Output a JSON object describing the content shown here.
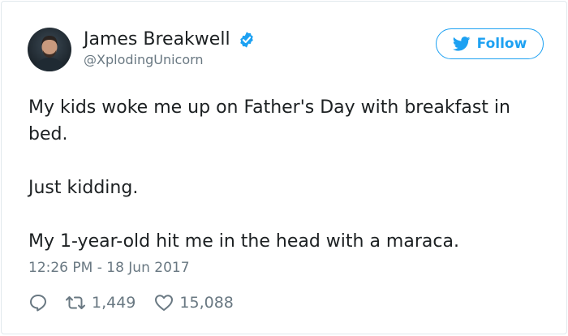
{
  "author": {
    "display_name": "James Breakwell",
    "username": "@XplodingUnicorn",
    "verified": true,
    "avatar_icon": "profile-photo"
  },
  "follow_button": {
    "label": "Follow",
    "icon": "twitter-bird-icon",
    "color": "#1da1f2"
  },
  "tweet": {
    "paragraphs": [
      "My kids woke me up on Father's Day with breakfast in bed.",
      "Just kidding.",
      "My 1-year-old hit me in the head with a maraca."
    ],
    "timestamp": "12:26 PM - 18 Jun 2017"
  },
  "actions": {
    "reply": {
      "icon": "reply-icon"
    },
    "retweet": {
      "icon": "retweet-icon",
      "count": "1,449"
    },
    "like": {
      "icon": "heart-icon",
      "count": "15,088"
    }
  },
  "colors": {
    "brand": "#1da1f2",
    "text": "#1c2022",
    "muted": "#697882",
    "border": "#e1e8ed"
  }
}
